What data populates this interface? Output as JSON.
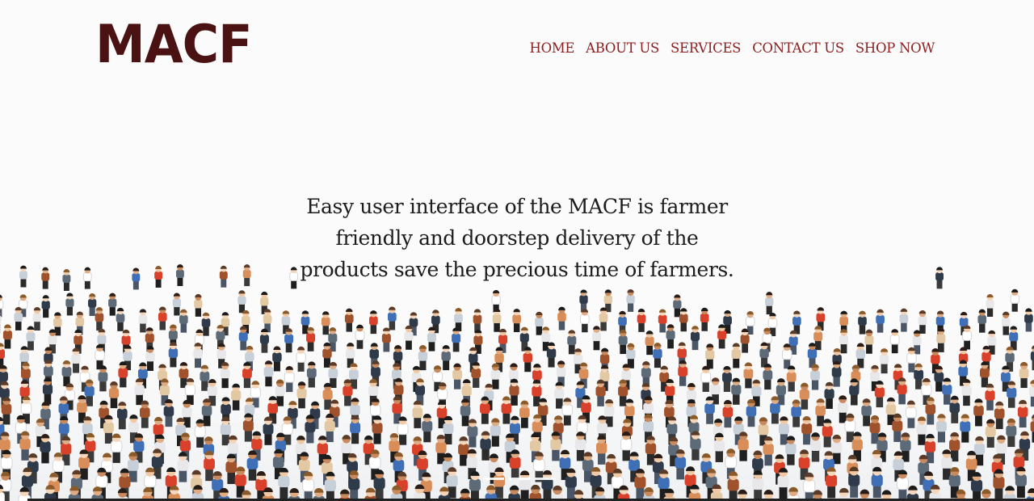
{
  "brand": {
    "logo_text": "MACF"
  },
  "nav": {
    "items": [
      {
        "label": "HOME"
      },
      {
        "label": "ABOUT US"
      },
      {
        "label": "SERVICES"
      },
      {
        "label": "CONTACT US"
      },
      {
        "label": "SHOP NOW"
      }
    ]
  },
  "hero": {
    "text": "Easy user interface of the MACF is farmer friendly and doorstep delivery of the products save the precious time of farmers."
  },
  "colors": {
    "brand": "#4a1212",
    "nav_link": "#8b1f1f",
    "background": "#fbfbfb"
  }
}
